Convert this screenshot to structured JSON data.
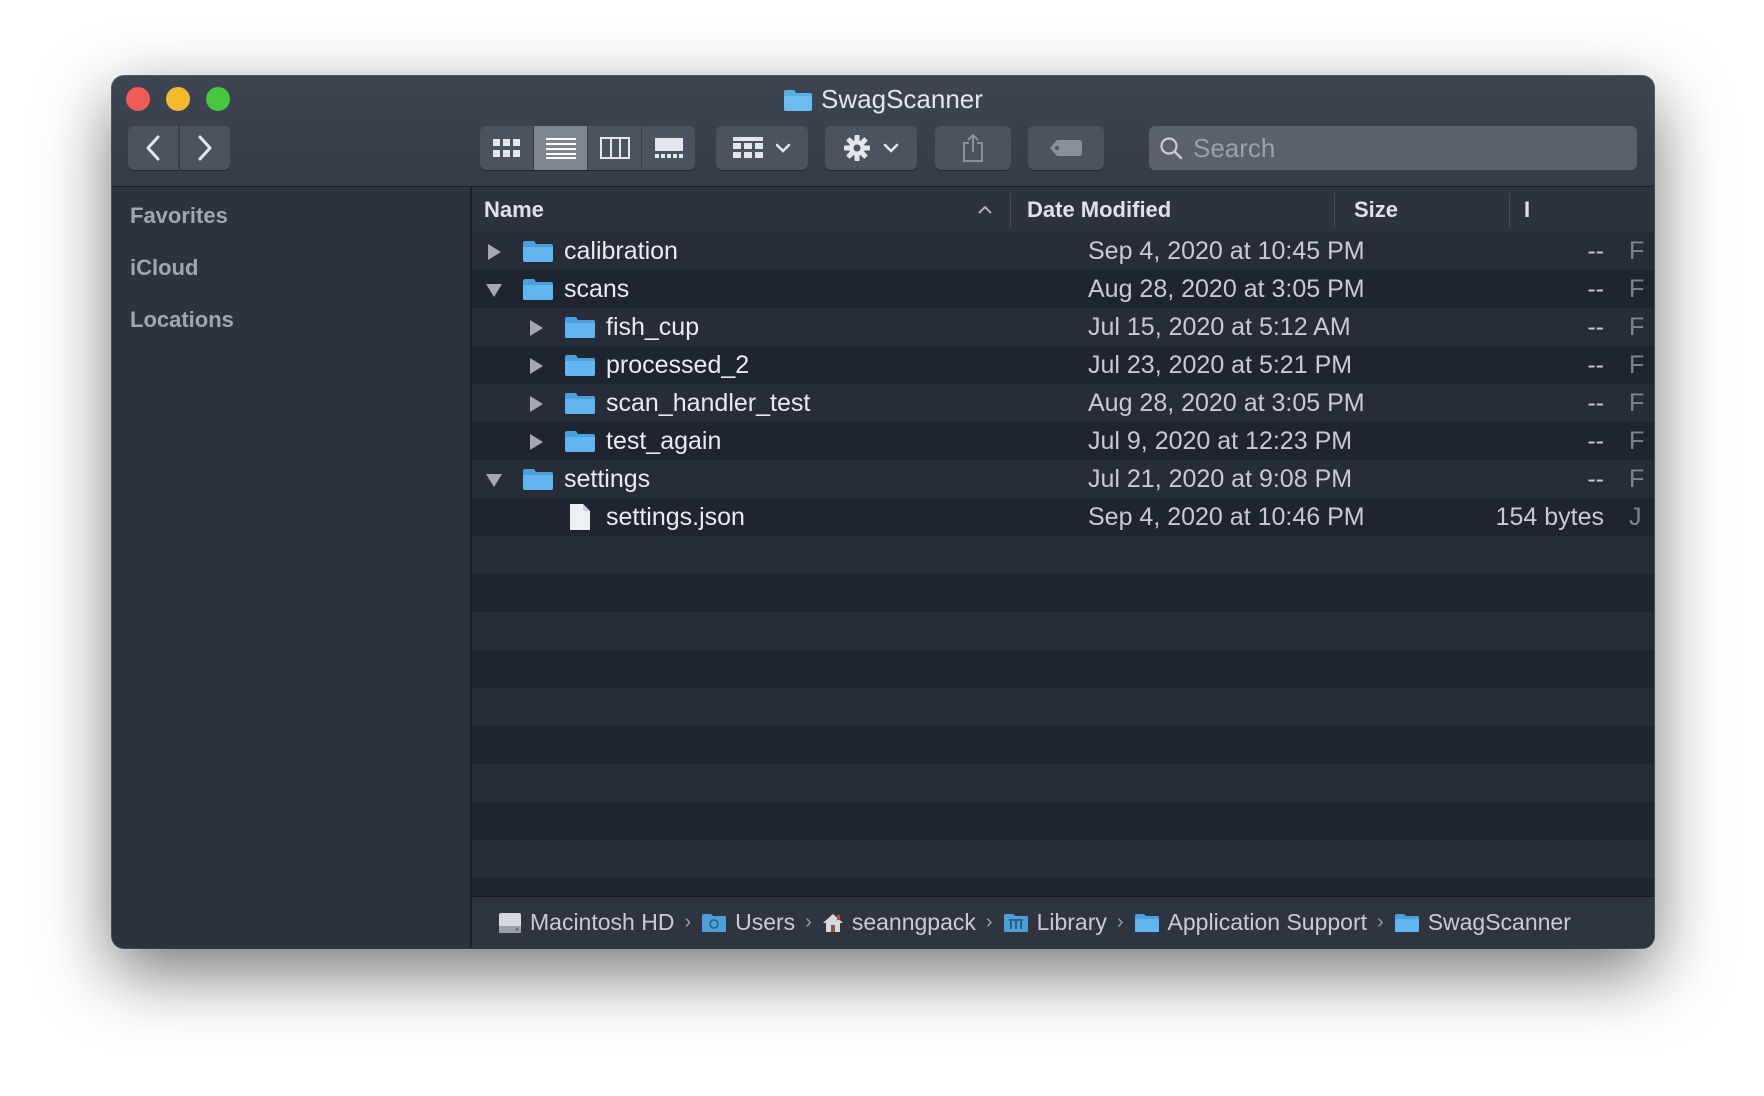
{
  "window": {
    "title": "SwagScanner"
  },
  "toolbar": {
    "search_placeholder": "Search"
  },
  "sidebar": {
    "sections": [
      {
        "label": "Favorites"
      },
      {
        "label": "iCloud"
      },
      {
        "label": "Locations"
      }
    ]
  },
  "columns": {
    "name": "Name",
    "date": "Date Modified",
    "size": "Size",
    "kind_partial": "I"
  },
  "rows": [
    {
      "name": "calibration",
      "date": "Sep 4, 2020 at 10:45 PM",
      "size": "--",
      "kind": "F",
      "icon": "folder-icon",
      "level": 0,
      "disclosure": "collapsed"
    },
    {
      "name": "scans",
      "date": "Aug 28, 2020 at 3:05 PM",
      "size": "--",
      "kind": "F",
      "icon": "folder-icon",
      "level": 0,
      "disclosure": "expanded"
    },
    {
      "name": "fish_cup",
      "date": "Jul 15, 2020 at 5:12 AM",
      "size": "--",
      "kind": "F",
      "icon": "folder-icon",
      "level": 1,
      "disclosure": "collapsed"
    },
    {
      "name": "processed_2",
      "date": "Jul 23, 2020 at 5:21 PM",
      "size": "--",
      "kind": "F",
      "icon": "folder-icon",
      "level": 1,
      "disclosure": "collapsed"
    },
    {
      "name": "scan_handler_test",
      "date": "Aug 28, 2020 at 3:05 PM",
      "size": "--",
      "kind": "F",
      "icon": "folder-icon",
      "level": 1,
      "disclosure": "collapsed"
    },
    {
      "name": "test_again",
      "date": "Jul 9, 2020 at 12:23 PM",
      "size": "--",
      "kind": "F",
      "icon": "folder-icon",
      "level": 1,
      "disclosure": "collapsed"
    },
    {
      "name": "settings",
      "date": "Jul 21, 2020 at 9:08 PM",
      "size": "--",
      "kind": "F",
      "icon": "folder-icon",
      "level": 0,
      "disclosure": "expanded"
    },
    {
      "name": "settings.json",
      "date": "Sep 4, 2020 at 10:46 PM",
      "size": "154 bytes",
      "kind": "J",
      "icon": "document-icon",
      "level": 1,
      "disclosure": "none"
    }
  ],
  "pathbar": [
    {
      "label": "Macintosh HD",
      "icon": "hard-drive-icon"
    },
    {
      "label": "Users",
      "icon": "users-folder-icon"
    },
    {
      "label": "seanngpack",
      "icon": "home-icon"
    },
    {
      "label": "Library",
      "icon": "library-folder-icon"
    },
    {
      "label": "Application Support",
      "icon": "folder-icon"
    },
    {
      "label": "SwagScanner",
      "icon": "folder-icon"
    }
  ],
  "colors": {
    "folder": "#5aaee6",
    "accent_close": "#ee5d55",
    "accent_minimize": "#f5b92d",
    "accent_maximize": "#47c63e"
  }
}
